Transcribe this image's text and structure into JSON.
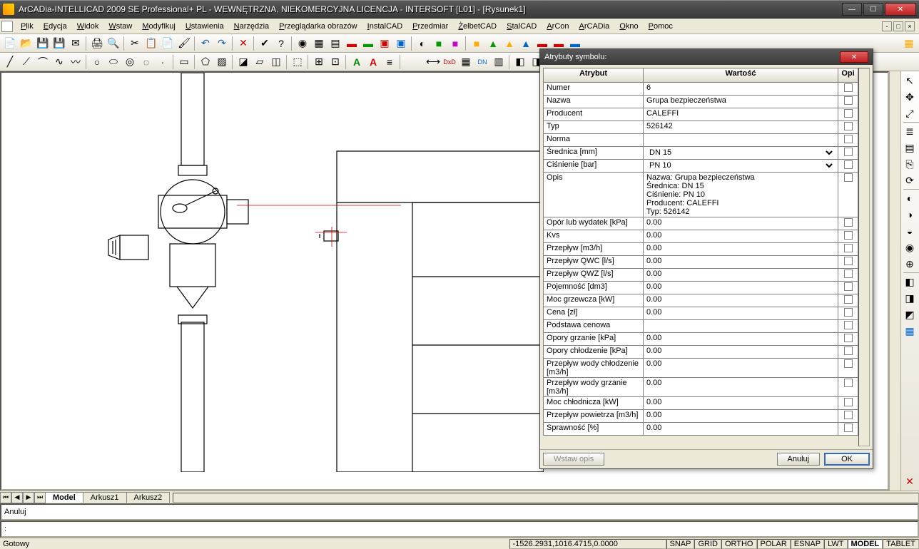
{
  "window": {
    "title": "ArCADia-INTELLICAD 2009 SE Professional+ PL - WEWNĘTRZNA, NIEKOMERCYJNA LICENCJA - INTERSOFT [L01] - [Rysunek1]"
  },
  "menu": [
    "Plik",
    "Edycja",
    "Widok",
    "Wstaw",
    "Modyfikuj",
    "Ustawienia",
    "Narzędzia",
    "Przeglądarka obrazów",
    "InstalCAD",
    "Przedmiar",
    "ŻelbetCAD",
    "StalCAD",
    "ArCon",
    "ArCADia",
    "Okno",
    "Pomoc"
  ],
  "tabs": {
    "items": [
      "Model",
      "Arkusz1",
      "Arkusz2"
    ],
    "active": 0
  },
  "command": {
    "history": "Anuluj",
    "prompt": ": "
  },
  "status": {
    "left": "Gotowy",
    "coords": "-1526.2931,1016.4715,0.0000",
    "toggles": [
      "SNAP",
      "GRID",
      "ORTHO",
      "POLAR",
      "ESNAP",
      "LWT",
      "MODEL",
      "TABLET"
    ],
    "active_toggle": 6
  },
  "dialog": {
    "title": "Atrybuty symbolu:",
    "headers": {
      "attr": "Atrybut",
      "val": "Wartość",
      "opis": "Opi"
    },
    "rows": [
      {
        "a": "Numer",
        "v": "6",
        "t": "text"
      },
      {
        "a": "Nazwa",
        "v": "Grupa bezpieczeństwa",
        "t": "text"
      },
      {
        "a": "Producent",
        "v": "CALEFFI",
        "t": "text"
      },
      {
        "a": "Typ",
        "v": "526142",
        "t": "text"
      },
      {
        "a": "Norma",
        "v": "",
        "t": "text"
      },
      {
        "a": "Średnica [mm]",
        "v": "DN 15",
        "t": "select"
      },
      {
        "a": "Ciśnienie [bar]",
        "v": "PN 10",
        "t": "select"
      },
      {
        "a": "Opis",
        "v": "Nazwa: Grupa bezpieczeństwa\nŚrednica: DN 15\nCiśnienie: PN 10\nProducent: CALEFFI\nTyp: 526142",
        "t": "multi"
      },
      {
        "a": "Opór lub wydatek [kPa]",
        "v": "0.00",
        "t": "text"
      },
      {
        "a": "Kvs",
        "v": "0.00",
        "t": "text"
      },
      {
        "a": "Przepływ [m3/h]",
        "v": "0.00",
        "t": "text"
      },
      {
        "a": "Przepływ QWC [l/s]",
        "v": "0.00",
        "t": "text"
      },
      {
        "a": "Przepływ QWZ [l/s]",
        "v": "0.00",
        "t": "text"
      },
      {
        "a": "Pojemność [dm3]",
        "v": "0.00",
        "t": "text"
      },
      {
        "a": "Moc grzewcza [kW]",
        "v": "0.00",
        "t": "text"
      },
      {
        "a": "Cena [zł]",
        "v": "0.00",
        "t": "text"
      },
      {
        "a": "Podstawa cenowa",
        "v": "",
        "t": "text"
      },
      {
        "a": "Opory grzanie [kPa]",
        "v": "0.00",
        "t": "text"
      },
      {
        "a": "Opory chłodzenie [kPa]",
        "v": "0.00",
        "t": "text"
      },
      {
        "a": "Przepływ wody chłodzenie [m3/h]",
        "v": "0.00",
        "t": "text"
      },
      {
        "a": "Przepływ wody grzanie [m3/h]",
        "v": "0.00",
        "t": "text"
      },
      {
        "a": "Moc chłodnicza [kW]",
        "v": "0.00",
        "t": "text"
      },
      {
        "a": "Przepływ powietrza [m3/h]",
        "v": "0.00",
        "t": "text"
      },
      {
        "a": "Sprawność [%]",
        "v": "0.00",
        "t": "text"
      }
    ],
    "buttons": {
      "insert": "Wstaw opis",
      "cancel": "Anuluj",
      "ok": "OK"
    }
  }
}
